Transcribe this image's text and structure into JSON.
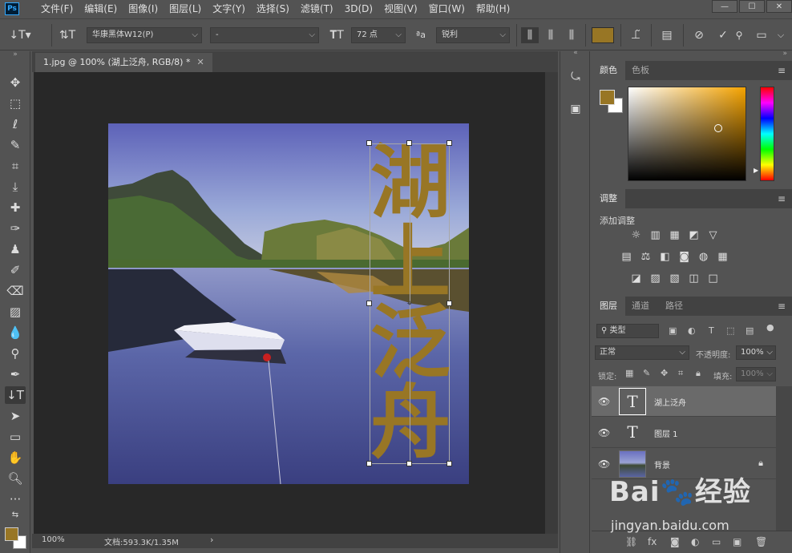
{
  "app": {
    "logo": "Ps",
    "menu": [
      "文件(F)",
      "编辑(E)",
      "图像(I)",
      "图层(L)",
      "文字(Y)",
      "选择(S)",
      "滤镜(T)",
      "3D(D)",
      "视图(V)",
      "窗口(W)",
      "帮助(H)"
    ],
    "window_controls": [
      "—",
      "☐",
      "✕"
    ]
  },
  "options_bar": {
    "font_family": "华康黑体W12(P)",
    "font_style": "-",
    "font_size": "72 点",
    "antialias": "锐利",
    "text_color": "#987625"
  },
  "document": {
    "tab_title": "1.jpg @ 100% (湖上泛舟, RGB/8) *",
    "tab_close": "✕",
    "text_layer_chars": [
      "湖",
      "上",
      "泛",
      "舟"
    ],
    "text_color": "#987625"
  },
  "status": {
    "zoom": "100%",
    "doc_size": "文档:593.3K/1.35M",
    "arrow": "›"
  },
  "panels": {
    "color": {
      "tabs": [
        "颜色",
        "色板"
      ],
      "fg": "#987625",
      "bg": "#ffffff"
    },
    "adjustments": {
      "tab": "调整",
      "label": "添加调整",
      "row1": [
        "☼",
        "▥",
        "▦",
        "◩",
        "▽"
      ],
      "row2": [
        "▤",
        "⚖",
        "◧",
        "◙",
        "◍",
        "▦"
      ],
      "row3": [
        "◪",
        "▨",
        "▧",
        "◫",
        "□"
      ]
    },
    "layers": {
      "tabs": [
        "图层",
        "通道",
        "路径"
      ],
      "filter_placeholder": "类型",
      "blend_mode": "正常",
      "opacity_label": "不透明度:",
      "opacity_value": "100%",
      "lock_label": "锁定:",
      "fill_label": "填充:",
      "fill_value": "100%",
      "items": [
        {
          "name": "湖上泛舟",
          "type": "T",
          "selected": true
        },
        {
          "name": "图层 1",
          "type": "T",
          "selected": false
        },
        {
          "name": "背景",
          "type": "image",
          "selected": false,
          "locked": true
        }
      ]
    }
  },
  "watermark": {
    "logo": "Bai🐾经验",
    "url": "jingyan.baidu.com"
  }
}
